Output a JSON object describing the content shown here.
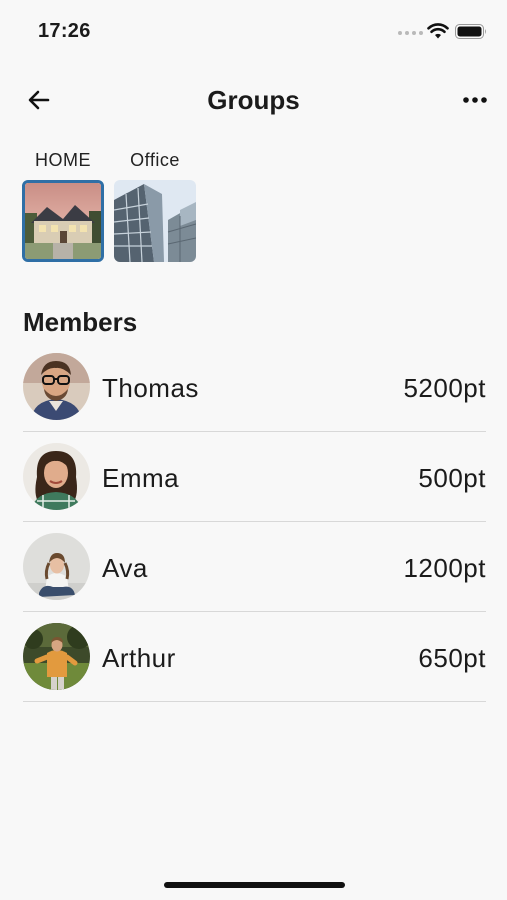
{
  "status_bar": {
    "time": "17:26"
  },
  "header": {
    "title": "Groups"
  },
  "groups": [
    {
      "name": "HOME",
      "selected": true
    },
    {
      "name": "Office",
      "selected": false
    }
  ],
  "members_section": {
    "title": "Members"
  },
  "members": [
    {
      "name": "Thomas",
      "points": "5200pt"
    },
    {
      "name": "Emma",
      "points": "500pt"
    },
    {
      "name": "Ava",
      "points": "1200pt"
    },
    {
      "name": "Arthur",
      "points": "650pt"
    }
  ],
  "colors": {
    "background": "#f8f8f8",
    "selected_border": "#2f6fa6",
    "divider": "#d8d8d8"
  },
  "icons": {
    "back": "arrow-left-icon",
    "more": "more-horizontal-icon"
  }
}
